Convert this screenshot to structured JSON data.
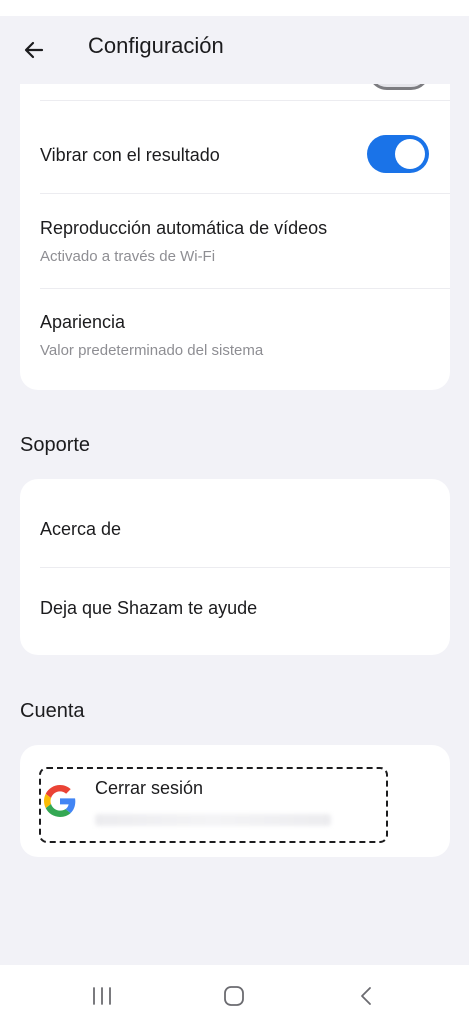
{
  "header": {
    "title": "Configuración",
    "back_icon": "arrow-left-icon"
  },
  "general": {
    "partial_row_toggle_state": "off",
    "vibrate": {
      "label": "Vibrar con el resultado",
      "state": "on"
    },
    "autoplay": {
      "label": "Reproducción automática de vídeos",
      "value": "Activado a través de Wi-Fi"
    },
    "appearance": {
      "label": "Apariencia",
      "value": "Valor predeterminado del sistema"
    }
  },
  "support": {
    "title": "Soporte",
    "items": [
      {
        "label": "Acerca de"
      },
      {
        "label": "Deja que Shazam te ayude"
      }
    ]
  },
  "account": {
    "title": "Cuenta",
    "sign_out_label": "Cerrar sesión",
    "provider_icon": "google-icon"
  },
  "navbar": {
    "icons": [
      "recent-apps-icon",
      "home-icon",
      "back-icon"
    ]
  },
  "colors": {
    "accent": "#1a73e8",
    "background": "#f2f2f7",
    "card": "#ffffff",
    "secondary_text": "#8e8e93"
  }
}
